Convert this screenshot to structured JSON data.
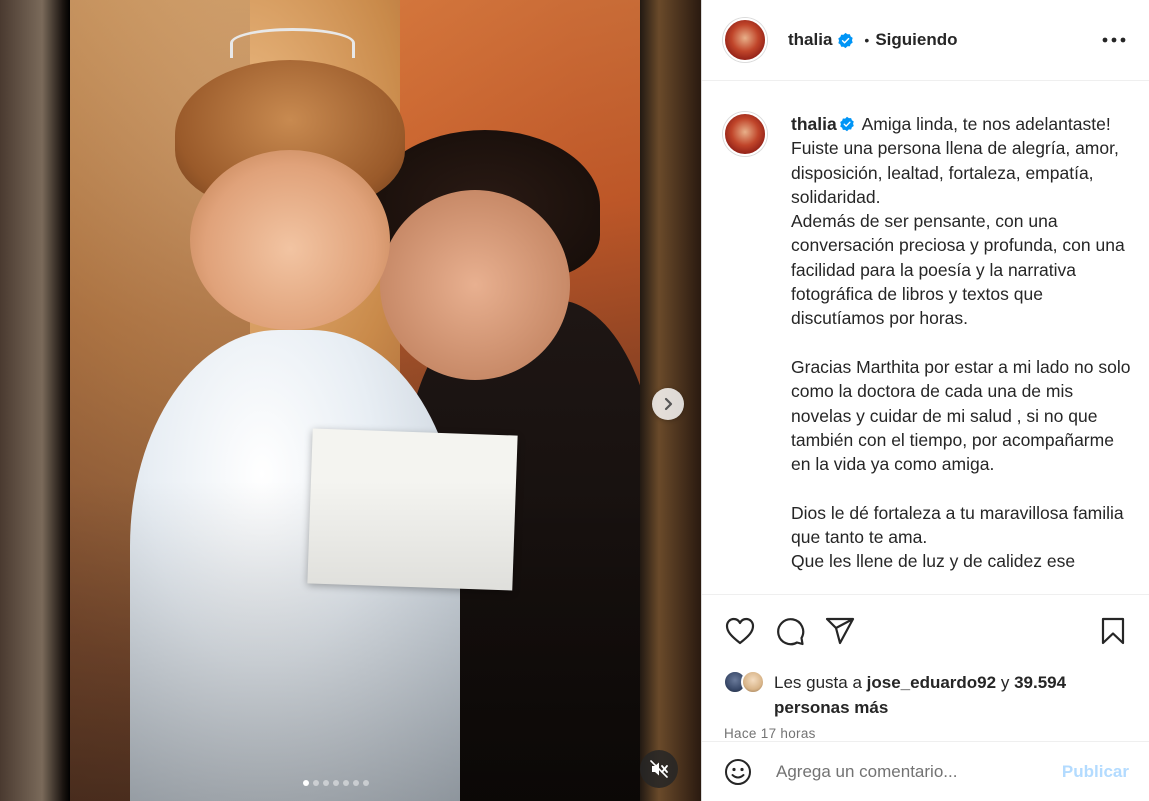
{
  "post": {
    "username": "thalia",
    "follow_status": "Siguiendo",
    "separator": "•"
  },
  "media": {
    "image_count": 7,
    "active_index": 0
  },
  "caption": {
    "username": "thalia",
    "lines": [
      "Amiga linda, te nos adelantaste! Fuiste una persona llena de alegría, amor, disposición, lealtad, fortaleza, empatía, solidaridad.",
      "Además de ser pensante, con una conversación preciosa y profunda, con una facilidad para la poesía y la narrativa fotográfica de libros y textos que discutíamos por horas.",
      "",
      "Gracias Marthita por estar a mi lado no solo como la doctora de cada una de mis novelas y cuidar de mi salud , si no que también con el tiempo, por acompañarme en la vida ya como amiga.",
      "",
      "Dios le dé fortaleza a tu maravillosa familia que tanto te ama.",
      "Que les llene de luz y de calidez ese"
    ]
  },
  "likes": {
    "prefix": "Les gusta a",
    "user": "jose_eduardo92",
    "conj": "y",
    "count": "39.594",
    "suffix": "personas más"
  },
  "timestamp": "Hace 17 horas",
  "comment_box": {
    "placeholder": "Agrega un comentario...",
    "publish_label": "Publicar"
  },
  "icons": {
    "verified": "verified-badge-icon",
    "more": "more-options-icon",
    "like": "heart-icon",
    "comment": "comment-icon",
    "share": "share-icon",
    "save": "bookmark-icon",
    "emoji": "emoji-icon",
    "next": "chevron-right-icon",
    "mute": "muted-speaker-icon"
  },
  "colors": {
    "verified_blue": "#0095f6",
    "publish_disabled": "#b3dbff",
    "secondary_text": "#737373"
  }
}
